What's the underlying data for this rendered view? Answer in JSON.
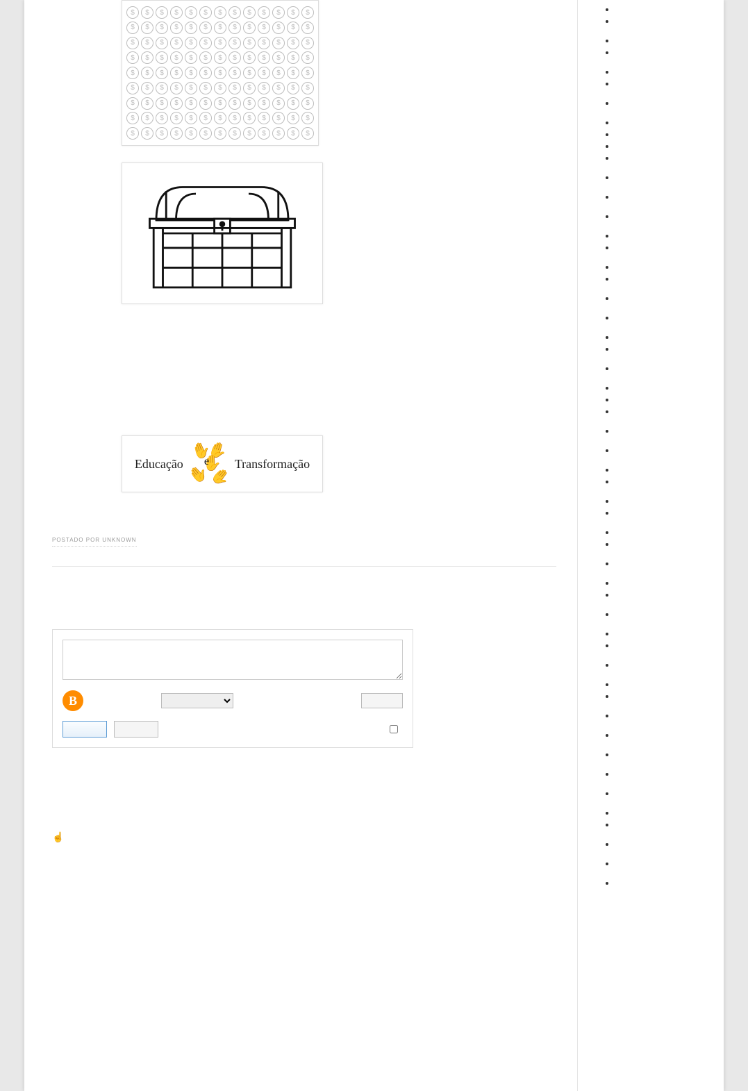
{
  "post": {
    "meta_label": "POSTADO POR  UNKNOWN"
  },
  "images": {
    "coin_sheet": {
      "rows": 9,
      "cols": 13
    },
    "logo": {
      "word_left": "Educação",
      "center_e": "e",
      "word_right": "Transformação"
    }
  },
  "comment": {
    "textarea_value": "",
    "select_value": "",
    "publish_label": "",
    "preview_label": "",
    "notify_label": ""
  },
  "sidebar": {
    "items": [
      {
        "label": ""
      },
      {
        "label": ""
      },
      {
        "label": ""
      },
      {
        "label": ""
      },
      {
        "label": ""
      },
      {
        "label": ""
      },
      {
        "label": ""
      },
      {
        "label": ""
      },
      {
        "label": ""
      },
      {
        "label": ""
      },
      {
        "label": ""
      },
      {
        "label": ""
      },
      {
        "label": ""
      },
      {
        "label": ""
      },
      {
        "label": ""
      },
      {
        "label": ""
      },
      {
        "label": ""
      },
      {
        "label": ""
      },
      {
        "label": ""
      },
      {
        "label": ""
      },
      {
        "label": ""
      },
      {
        "label": ""
      },
      {
        "label": ""
      },
      {
        "label": ""
      },
      {
        "label": ""
      },
      {
        "label": ""
      },
      {
        "label": ""
      },
      {
        "label": ""
      },
      {
        "label": ""
      },
      {
        "label": ""
      },
      {
        "label": ""
      },
      {
        "label": ""
      },
      {
        "label": ""
      },
      {
        "label": ""
      },
      {
        "label": ""
      },
      {
        "label": ""
      },
      {
        "label": ""
      },
      {
        "label": ""
      },
      {
        "label": ""
      },
      {
        "label": ""
      },
      {
        "label": ""
      },
      {
        "label": ""
      },
      {
        "label": ""
      },
      {
        "label": ""
      },
      {
        "label": ""
      },
      {
        "label": ""
      },
      {
        "label": ""
      },
      {
        "label": ""
      },
      {
        "label": ""
      },
      {
        "label": ""
      },
      {
        "label": ""
      },
      {
        "label": ""
      },
      {
        "label": ""
      }
    ]
  },
  "pointer": {
    "glyph": "☝"
  }
}
